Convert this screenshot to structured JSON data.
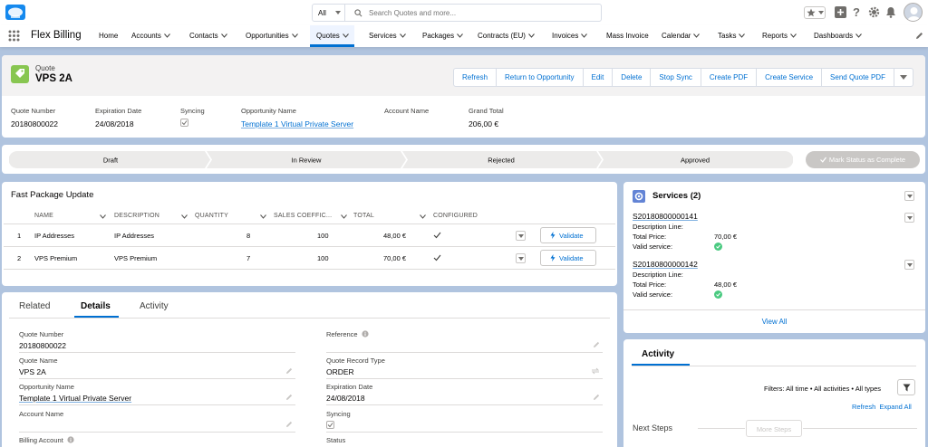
{
  "header": {
    "search_scope": "All",
    "search_placeholder": "Search Quotes and more..."
  },
  "nav": {
    "app_name": "Flex Billing",
    "items": [
      {
        "label": "Home",
        "has_menu": false
      },
      {
        "label": "Accounts",
        "has_menu": true
      },
      {
        "label": "Contacts",
        "has_menu": true
      },
      {
        "label": "Opportunities",
        "has_menu": true
      },
      {
        "label": "Quotes",
        "has_menu": true,
        "active": true
      },
      {
        "label": "Services",
        "has_menu": true
      },
      {
        "label": "Packages",
        "has_menu": true
      },
      {
        "label": "Contracts (EU)",
        "has_menu": true
      },
      {
        "label": "Invoices",
        "has_menu": true
      },
      {
        "label": "Mass Invoice",
        "has_menu": false
      },
      {
        "label": "Calendar",
        "has_menu": true
      },
      {
        "label": "Tasks",
        "has_menu": true
      },
      {
        "label": "Reports",
        "has_menu": true
      },
      {
        "label": "Dashboards",
        "has_menu": true
      }
    ]
  },
  "record": {
    "object_label": "Quote",
    "title": "VPS 2A",
    "actions": [
      "Refresh",
      "Return to Opportunity",
      "Edit",
      "Delete",
      "Stop Sync",
      "Create PDF",
      "Create Service",
      "Send Quote PDF"
    ],
    "highlights": {
      "quote_number_label": "Quote Number",
      "quote_number": "20180800022",
      "expiration_label": "Expiration Date",
      "expiration": "24/08/2018",
      "syncing_label": "Syncing",
      "opportunity_label": "Opportunity Name",
      "opportunity": "Template 1 Virtual Private Server",
      "account_label": "Account Name",
      "grand_total_label": "Grand Total",
      "grand_total": "206,00 €"
    }
  },
  "path": {
    "stages": [
      "Draft",
      "In Review",
      "Rejected",
      "Approved"
    ],
    "mark_button": "Mark Status as Complete"
  },
  "fast_package": {
    "title": "Fast Package Update",
    "columns": [
      "NAME",
      "DESCRIPTION",
      "QUANTITY",
      "SALES COEFFIC...",
      "TOTAL",
      "CONFIGURED"
    ],
    "rows": [
      {
        "num": "1",
        "name": "IP Addresses",
        "description": "IP Addresses",
        "quantity": "8",
        "coefficient": "100",
        "total": "48,00 €",
        "configured": true,
        "action": "Validate"
      },
      {
        "num": "2",
        "name": "VPS Premium",
        "description": "VPS Premium",
        "quantity": "7",
        "coefficient": "100",
        "total": "70,00 €",
        "configured": true,
        "action": "Validate"
      }
    ]
  },
  "services": {
    "title": "Services (2)",
    "items": [
      {
        "id": "S20180800000141",
        "desc_label": "Description Line:",
        "price_label": "Total Price:",
        "price": "70,00 €",
        "valid_label": "Valid service:"
      },
      {
        "id": "S20180800000142",
        "desc_label": "Description Line:",
        "price_label": "Total Price:",
        "price": "48,00 €",
        "valid_label": "Valid service:"
      }
    ],
    "view_all": "View All"
  },
  "details": {
    "tabs": [
      "Related",
      "Details",
      "Activity"
    ],
    "active_tab": "Details",
    "left_fields": [
      {
        "label": "Quote Number",
        "value": "20180800022",
        "link": false
      },
      {
        "label": "Quote Name",
        "value": "VPS 2A",
        "link": false
      },
      {
        "label": "Opportunity Name",
        "value": "Template 1 Virtual Private Server",
        "link": true
      },
      {
        "label": "Account Name",
        "value": "",
        "link": false
      },
      {
        "label": "Billing Account",
        "value": "",
        "link": false
      }
    ],
    "right_fields": [
      {
        "label": "Reference",
        "value": ""
      },
      {
        "label": "Quote Record Type",
        "value": "ORDER"
      },
      {
        "label": "Expiration Date",
        "value": "24/08/2018"
      },
      {
        "label": "Syncing",
        "value": ""
      },
      {
        "label": "Status",
        "value": ""
      }
    ]
  },
  "activity": {
    "title": "Activity",
    "filters": "Filters: All time • All activities • All types",
    "refresh": "Refresh",
    "expand_all": "Expand All",
    "next_steps": "Next Steps",
    "more_steps": "More Steps"
  },
  "colors": {
    "brand": "#0070d2",
    "quote_icon": "#88c651",
    "service_icon": "#6384d5",
    "success": "#4bca81"
  }
}
